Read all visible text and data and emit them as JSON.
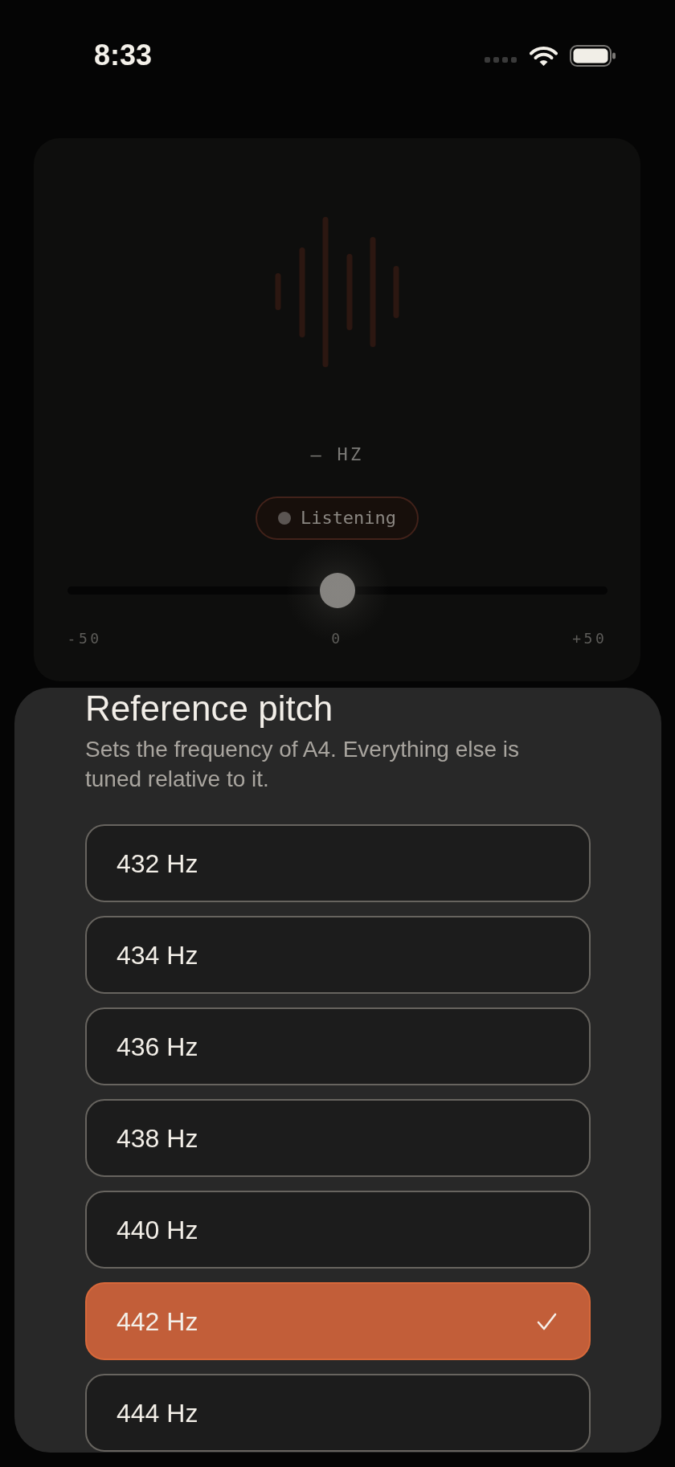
{
  "status_bar": {
    "time": "8:33"
  },
  "tuner": {
    "readout": "— HZ",
    "status": {
      "label": "Listening"
    },
    "meter": {
      "level": 0.5,
      "labels": [
        "-50",
        "0",
        "+50"
      ]
    }
  },
  "sheet": {
    "title": "Reference pitch",
    "description": "Sets the frequency of A4. Everything else is tuned relative to it.",
    "options": [
      {
        "label": "432 Hz",
        "selected": false
      },
      {
        "label": "434 Hz",
        "selected": false
      },
      {
        "label": "436 Hz",
        "selected": false
      },
      {
        "label": "438 Hz",
        "selected": false
      },
      {
        "label": "440 Hz",
        "selected": false
      },
      {
        "label": "442 Hz",
        "selected": true
      },
      {
        "label": "444 Hz",
        "selected": false
      }
    ]
  }
}
